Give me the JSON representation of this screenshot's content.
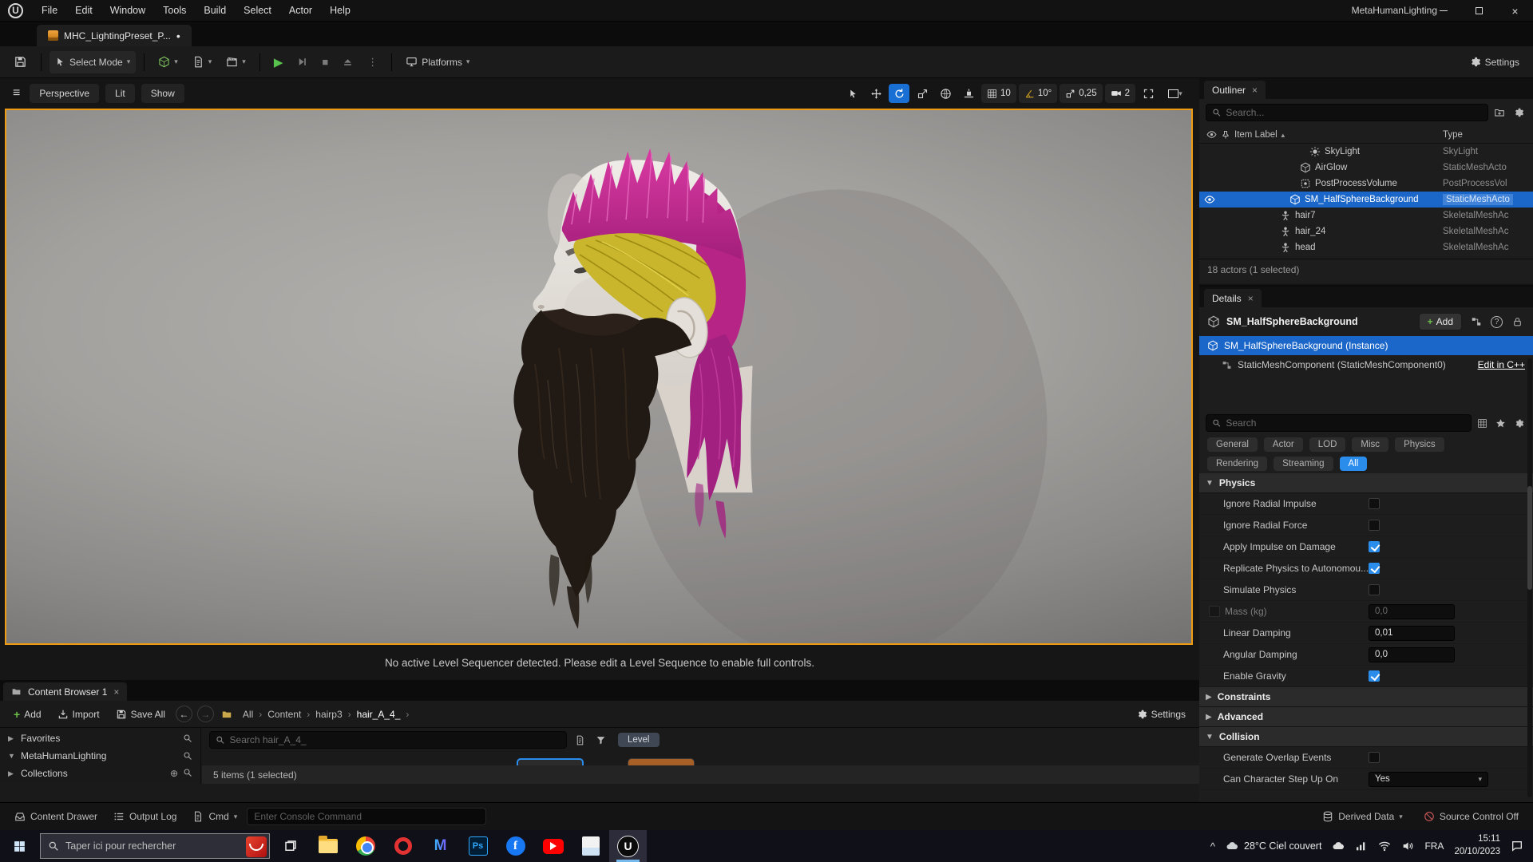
{
  "ui_colors": {
    "accent_blue": "#2a8ceb",
    "selection_blue": "#1b66c9",
    "viewport_border_orange": "#ee9a12",
    "play_green": "#58c24f",
    "tab_asset_orange": "#e8a33d"
  },
  "menu_bar": {
    "items": [
      "File",
      "Edit",
      "Window",
      "Tools",
      "Build",
      "Select",
      "Actor",
      "Help"
    ],
    "window_title": "MetaHumanLighting"
  },
  "asset_tab": {
    "label": "MHC_LightingPreset_P...",
    "dirty_indicator": "•"
  },
  "toolbar": {
    "select_mode_label": "Select Mode",
    "platforms_label": "Platforms",
    "settings_label": "Settings"
  },
  "viewport": {
    "perspective_label": "Perspective",
    "lit_label": "Lit",
    "show_label": "Show",
    "grid_snap_value": "10",
    "rotation_snap_value": "10°",
    "scale_snap_value": "0,25",
    "camera_speed_value": "2",
    "sequencer_message": "No active Level Sequencer detected. Please edit a Level Sequence to enable full controls."
  },
  "outliner": {
    "tab_title": "Outliner",
    "search_placeholder": "Search...",
    "col_item_label": "Item Label",
    "col_type": "Type",
    "rows": [
      {
        "label": "SkyLight",
        "type": "SkyLight"
      },
      {
        "label": "AirGlow",
        "type": "StaticMeshActo"
      },
      {
        "label": "PostProcessVolume",
        "type": "PostProcessVol"
      },
      {
        "label": "SM_HalfSphereBackground",
        "type": "StaticMeshActo"
      },
      {
        "label": "hair7",
        "type": "SkeletalMeshAc"
      },
      {
        "label": "hair_24",
        "type": "SkeletalMeshAc"
      },
      {
        "label": "head",
        "type": "SkeletalMeshAc"
      }
    ],
    "footer": "18 actors (1 selected)"
  },
  "details": {
    "tab_title": "Details",
    "object_name": "SM_HalfSphereBackground",
    "add_button_label": "Add",
    "instance_label": "SM_HalfSphereBackground (Instance)",
    "component_label": "StaticMeshComponent (StaticMeshComponent0)",
    "edit_cpp_label": "Edit in C++",
    "search_placeholder": "Search",
    "filters": [
      "General",
      "Actor",
      "LOD",
      "Misc",
      "Physics",
      "Rendering",
      "Streaming",
      "All"
    ],
    "active_filter": "All",
    "physics_section": "Physics",
    "physics_rows": [
      {
        "label": "Ignore Radial Impulse",
        "control": "checkbox",
        "checked": false
      },
      {
        "label": "Ignore Radial Force",
        "control": "checkbox",
        "checked": false
      },
      {
        "label": "Apply Impulse on Damage",
        "control": "checkbox",
        "checked": true
      },
      {
        "label": "Replicate Physics to Autonomou...",
        "control": "checkbox",
        "checked": true
      },
      {
        "label": "Simulate Physics",
        "control": "checkbox",
        "checked": false
      },
      {
        "label": "Mass (kg)",
        "control": "number",
        "value": "0,0",
        "disabled": true
      },
      {
        "label": "Linear Damping",
        "control": "number",
        "value": "0,01"
      },
      {
        "label": "Angular Damping",
        "control": "number",
        "value": "0,0"
      },
      {
        "label": "Enable Gravity",
        "control": "checkbox",
        "checked": true
      }
    ],
    "constraints_section": "Constraints",
    "advanced_section": "Advanced",
    "collision_section": "Collision",
    "collision_rows": [
      {
        "label": "Generate Overlap Events",
        "control": "checkbox",
        "checked": false
      },
      {
        "label": "Can Character Step Up On",
        "control": "dropdown",
        "value": "Yes"
      }
    ]
  },
  "content_browser": {
    "tab_title": "Content Browser 1",
    "add_label": "Add",
    "import_label": "Import",
    "save_all_label": "Save All",
    "breadcrumbs": [
      "All",
      "Content",
      "hairp3",
      "hair_A_4_"
    ],
    "settings_label": "Settings",
    "favorites_label": "Favorites",
    "project_label": "MetaHumanLighting",
    "collections_label": "Collections",
    "search_placeholder": "Search hair_A_4_",
    "level_filter_label": "Level",
    "footer": "5 items (1 selected)"
  },
  "status_bar": {
    "content_drawer_label": "Content Drawer",
    "output_log_label": "Output Log",
    "cmd_label": "Cmd",
    "console_placeholder": "Enter Console Command",
    "derived_data_label": "Derived Data",
    "source_control_label": "Source Control Off"
  },
  "taskbar": {
    "search_placeholder": "Taper ici pour rechercher",
    "weather_label": "28°C Ciel couvert",
    "language_label": "FRA",
    "clock_time": "15:11",
    "clock_date": "20/10/2023"
  }
}
